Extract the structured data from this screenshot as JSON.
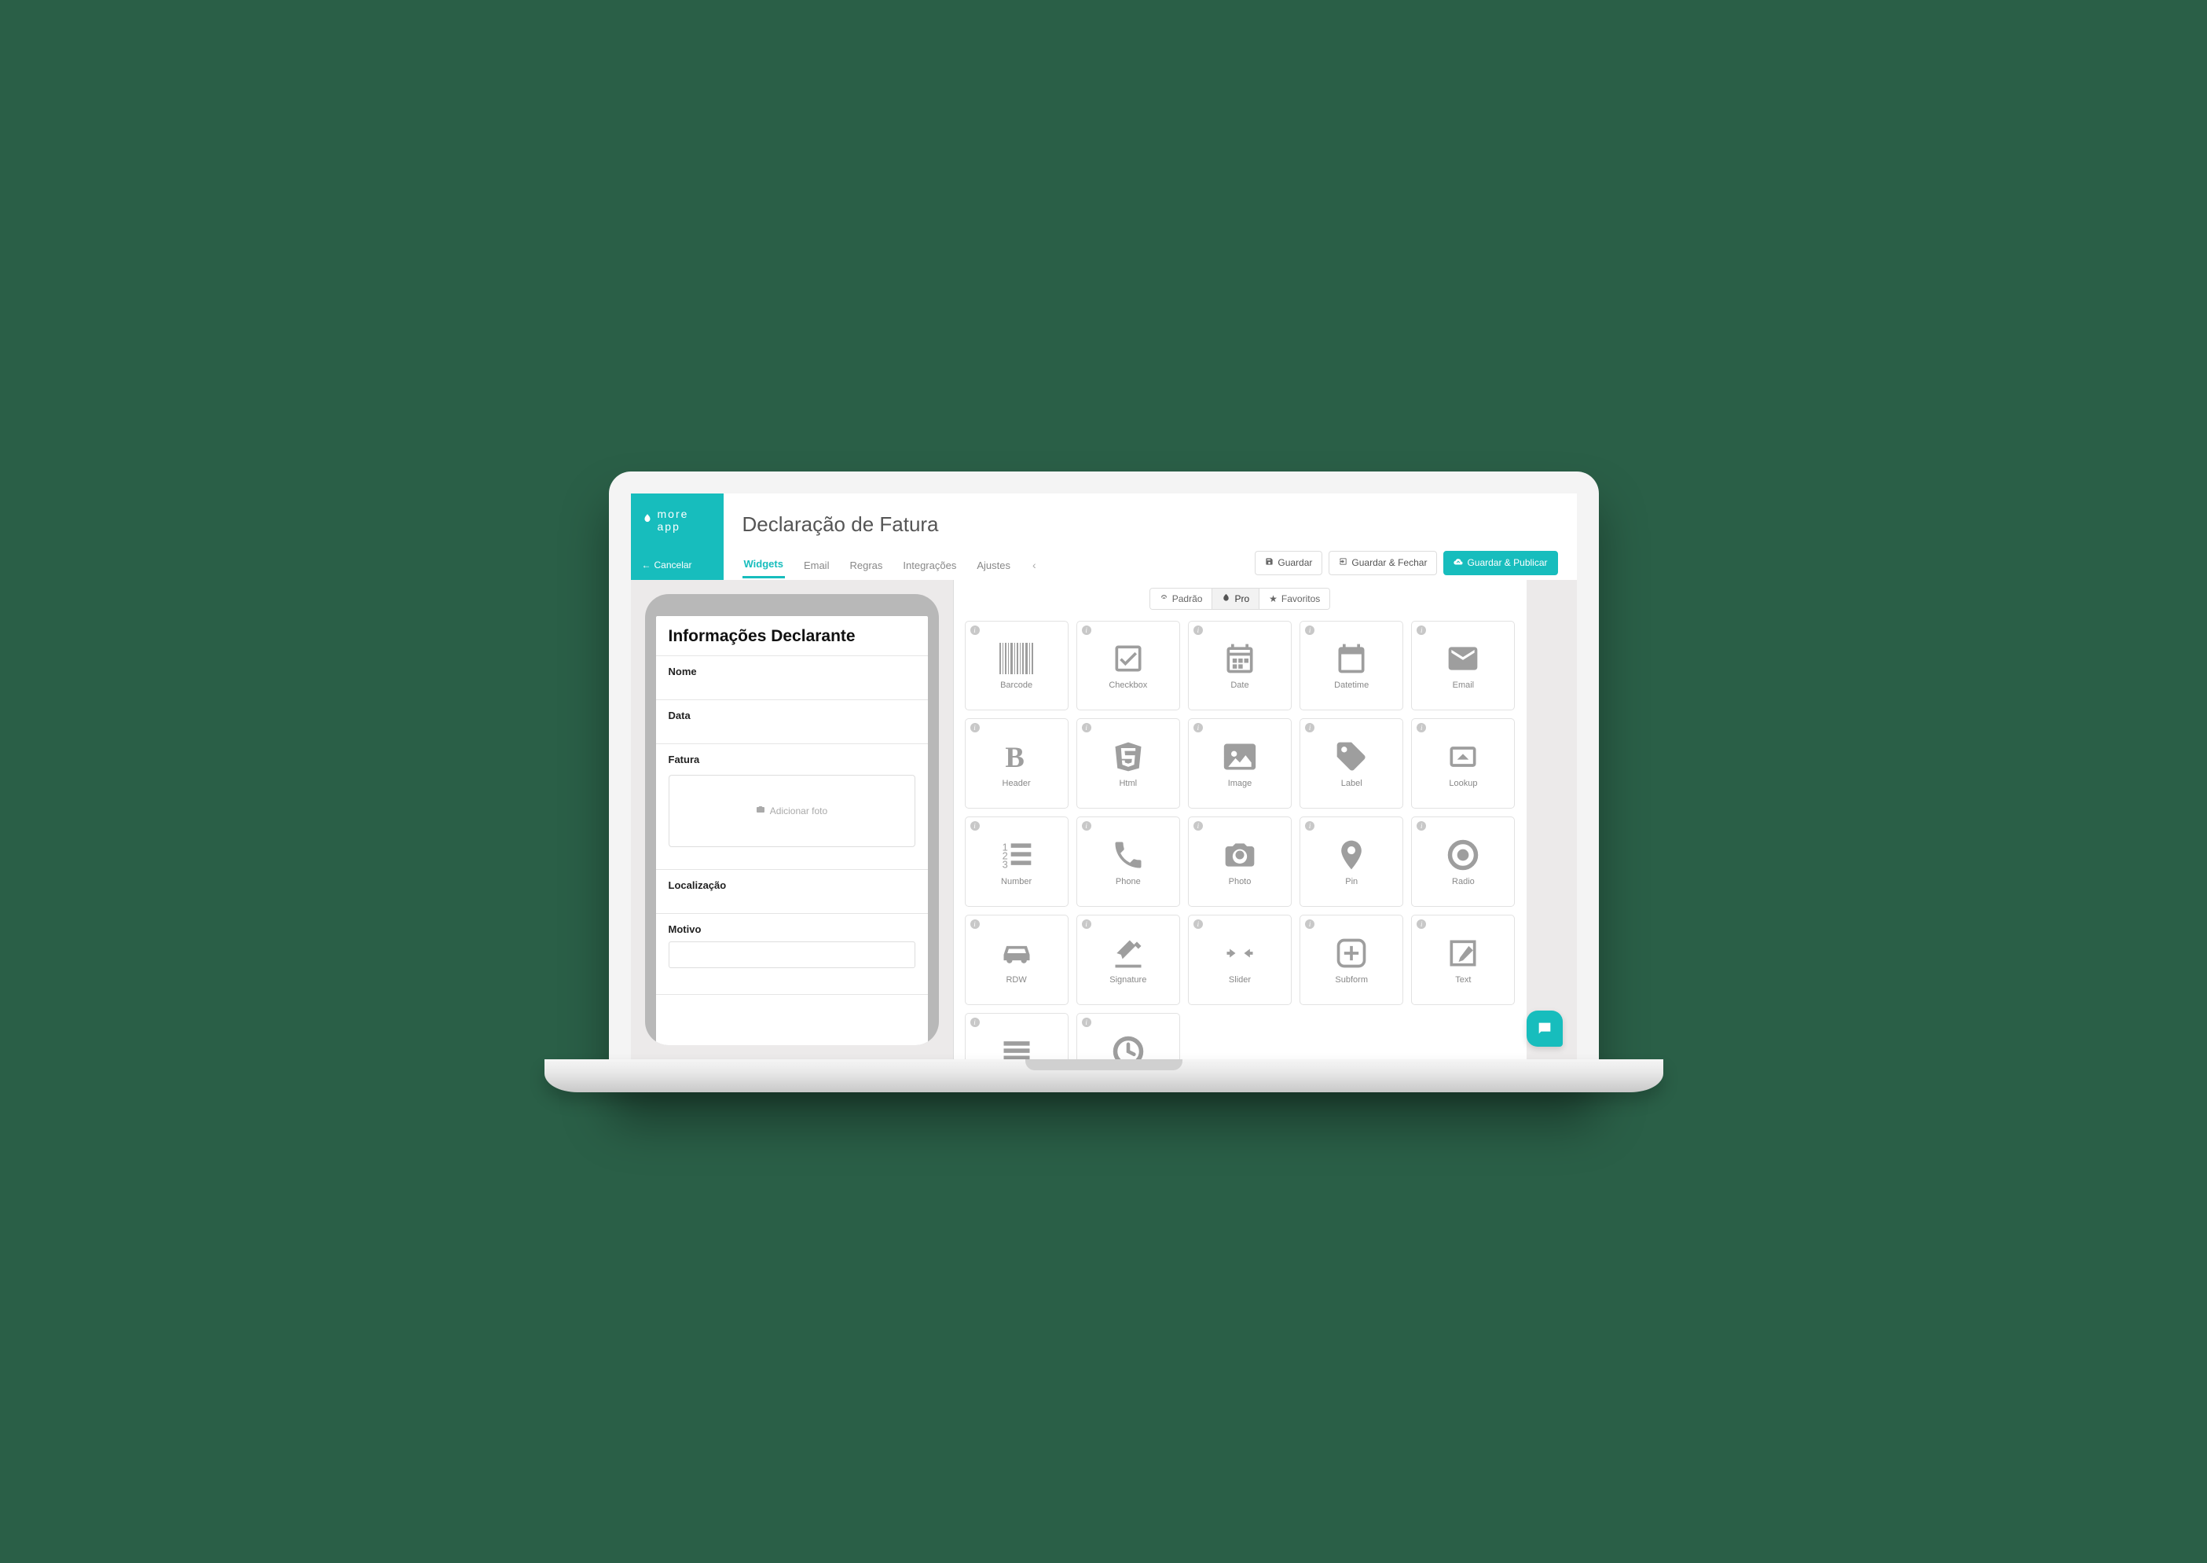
{
  "brand": "more app",
  "cancel": "Cancelar",
  "title": "Declaração de Fatura",
  "tabs": [
    "Widgets",
    "Email",
    "Regras",
    "Integrações",
    "Ajustes"
  ],
  "active_tab": "Widgets",
  "actions": {
    "save": "Guardar",
    "save_close": "Guardar & Fechar",
    "save_publish": "Guardar & Publicar"
  },
  "preview": {
    "heading": "Informações Declarante",
    "fields": {
      "nome": "Nome",
      "data": "Data",
      "fatura": "Fatura",
      "add_photo": "Adicionar foto",
      "localizacao": "Localização",
      "motivo": "Motivo"
    }
  },
  "widget_filters": {
    "padrao": "Padrão",
    "pro": "Pro",
    "favoritos": "Favoritos",
    "active": "Pro"
  },
  "widgets": [
    {
      "id": "barcode",
      "label": "Barcode"
    },
    {
      "id": "checkbox",
      "label": "Checkbox"
    },
    {
      "id": "date",
      "label": "Date"
    },
    {
      "id": "datetime",
      "label": "Datetime"
    },
    {
      "id": "email",
      "label": "Email"
    },
    {
      "id": "header",
      "label": "Header"
    },
    {
      "id": "html",
      "label": "Html"
    },
    {
      "id": "image",
      "label": "Image"
    },
    {
      "id": "label",
      "label": "Label"
    },
    {
      "id": "lookup",
      "label": "Lookup"
    },
    {
      "id": "number",
      "label": "Number"
    },
    {
      "id": "phone",
      "label": "Phone"
    },
    {
      "id": "photo",
      "label": "Photo"
    },
    {
      "id": "pin",
      "label": "Pin"
    },
    {
      "id": "radio",
      "label": "Radio"
    },
    {
      "id": "rdw",
      "label": "RDW"
    },
    {
      "id": "signature",
      "label": "Signature"
    },
    {
      "id": "slider",
      "label": "Slider"
    },
    {
      "id": "subform",
      "label": "Subform"
    },
    {
      "id": "text",
      "label": "Text"
    },
    {
      "id": "textarea",
      "label": "Text Area"
    },
    {
      "id": "time",
      "label": "Time"
    }
  ]
}
